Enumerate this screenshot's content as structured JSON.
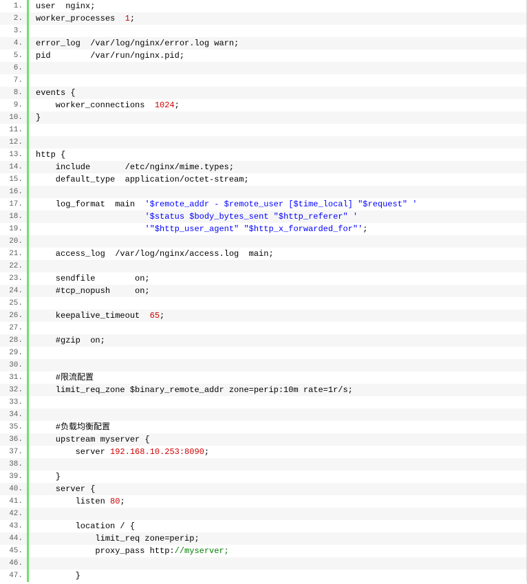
{
  "lines": [
    {
      "n": "1.",
      "tokens": [
        {
          "c": "t-plain",
          "t": "user  nginx;"
        }
      ]
    },
    {
      "n": "2.",
      "tokens": [
        {
          "c": "t-plain",
          "t": "worker_processes  "
        },
        {
          "c": "t-num",
          "t": "1"
        },
        {
          "c": "t-plain",
          "t": ";"
        }
      ]
    },
    {
      "n": "3.",
      "tokens": []
    },
    {
      "n": "4.",
      "tokens": [
        {
          "c": "t-plain",
          "t": "error_log  /var/log/nginx/error.log warn;"
        }
      ]
    },
    {
      "n": "5.",
      "tokens": [
        {
          "c": "t-plain",
          "t": "pid        /var/run/nginx.pid;"
        }
      ]
    },
    {
      "n": "6.",
      "tokens": []
    },
    {
      "n": "7.",
      "tokens": []
    },
    {
      "n": "8.",
      "tokens": [
        {
          "c": "t-plain",
          "t": "events {"
        }
      ]
    },
    {
      "n": "9.",
      "tokens": [
        {
          "c": "t-plain",
          "t": "    worker_connections  "
        },
        {
          "c": "t-num",
          "t": "1024"
        },
        {
          "c": "t-plain",
          "t": ";"
        }
      ]
    },
    {
      "n": "10.",
      "tokens": [
        {
          "c": "t-plain",
          "t": "}"
        }
      ]
    },
    {
      "n": "11.",
      "tokens": []
    },
    {
      "n": "12.",
      "tokens": []
    },
    {
      "n": "13.",
      "tokens": [
        {
          "c": "t-plain",
          "t": "http {"
        }
      ]
    },
    {
      "n": "14.",
      "tokens": [
        {
          "c": "t-plain",
          "t": "    include       /etc/nginx/mime.types;"
        }
      ]
    },
    {
      "n": "15.",
      "tokens": [
        {
          "c": "t-plain",
          "t": "    default_type  application/octet-stream;"
        }
      ]
    },
    {
      "n": "16.",
      "tokens": []
    },
    {
      "n": "17.",
      "tokens": [
        {
          "c": "t-plain",
          "t": "    log_format  main  "
        },
        {
          "c": "t-str",
          "t": "'$remote_addr - $remote_user [$time_local] \"$request\" '"
        }
      ]
    },
    {
      "n": "18.",
      "tokens": [
        {
          "c": "t-plain",
          "t": "                      "
        },
        {
          "c": "t-str",
          "t": "'$status $body_bytes_sent \"$http_referer\" '"
        }
      ]
    },
    {
      "n": "19.",
      "tokens": [
        {
          "c": "t-plain",
          "t": "                      "
        },
        {
          "c": "t-str",
          "t": "'\"$http_user_agent\" \"$http_x_forwarded_for\"'"
        },
        {
          "c": "t-plain",
          "t": ";"
        }
      ]
    },
    {
      "n": "20.",
      "tokens": []
    },
    {
      "n": "21.",
      "tokens": [
        {
          "c": "t-plain",
          "t": "    access_log  /var/log/nginx/access.log  main;"
        }
      ]
    },
    {
      "n": "22.",
      "tokens": []
    },
    {
      "n": "23.",
      "tokens": [
        {
          "c": "t-plain",
          "t": "    sendfile        on;"
        }
      ]
    },
    {
      "n": "24.",
      "tokens": [
        {
          "c": "t-plain",
          "t": "    #tcp_nopush     on;"
        }
      ]
    },
    {
      "n": "25.",
      "tokens": []
    },
    {
      "n": "26.",
      "tokens": [
        {
          "c": "t-plain",
          "t": "    keepalive_timeout  "
        },
        {
          "c": "t-num",
          "t": "65"
        },
        {
          "c": "t-plain",
          "t": ";"
        }
      ]
    },
    {
      "n": "27.",
      "tokens": []
    },
    {
      "n": "28.",
      "tokens": [
        {
          "c": "t-plain",
          "t": "    #gzip  on;"
        }
      ]
    },
    {
      "n": "29.",
      "tokens": []
    },
    {
      "n": "30.",
      "tokens": []
    },
    {
      "n": "31.",
      "tokens": [
        {
          "c": "t-plain",
          "t": "    #限流配置"
        }
      ]
    },
    {
      "n": "32.",
      "tokens": [
        {
          "c": "t-plain",
          "t": "    limit_req_zone $binary_remote_addr zone=perip:10m rate=1r/s;"
        }
      ]
    },
    {
      "n": "33.",
      "tokens": []
    },
    {
      "n": "34.",
      "tokens": []
    },
    {
      "n": "35.",
      "tokens": [
        {
          "c": "t-plain",
          "t": "    #负载均衡配置"
        }
      ]
    },
    {
      "n": "36.",
      "tokens": [
        {
          "c": "t-plain",
          "t": "    upstream myserver {"
        }
      ]
    },
    {
      "n": "37.",
      "tokens": [
        {
          "c": "t-plain",
          "t": "        server "
        },
        {
          "c": "t-ip",
          "t": "192.168.10.253:8090"
        },
        {
          "c": "t-plain",
          "t": ";"
        }
      ]
    },
    {
      "n": "38.",
      "tokens": []
    },
    {
      "n": "39.",
      "tokens": [
        {
          "c": "t-plain",
          "t": "    }"
        }
      ]
    },
    {
      "n": "40.",
      "tokens": [
        {
          "c": "t-plain",
          "t": "    server {"
        }
      ]
    },
    {
      "n": "41.",
      "tokens": [
        {
          "c": "t-plain",
          "t": "        listen "
        },
        {
          "c": "t-num",
          "t": "80"
        },
        {
          "c": "t-plain",
          "t": ";"
        }
      ]
    },
    {
      "n": "42.",
      "tokens": []
    },
    {
      "n": "43.",
      "tokens": [
        {
          "c": "t-plain",
          "t": "        location / {"
        }
      ]
    },
    {
      "n": "44.",
      "tokens": [
        {
          "c": "t-plain",
          "t": "            limit_req zone=perip;"
        }
      ]
    },
    {
      "n": "45.",
      "tokens": [
        {
          "c": "t-plain",
          "t": "            proxy_pass http:"
        },
        {
          "c": "t-url",
          "t": "//myserver;"
        }
      ]
    },
    {
      "n": "46.",
      "tokens": []
    },
    {
      "n": "47.",
      "tokens": [
        {
          "c": "t-plain",
          "t": "        }"
        }
      ]
    }
  ]
}
